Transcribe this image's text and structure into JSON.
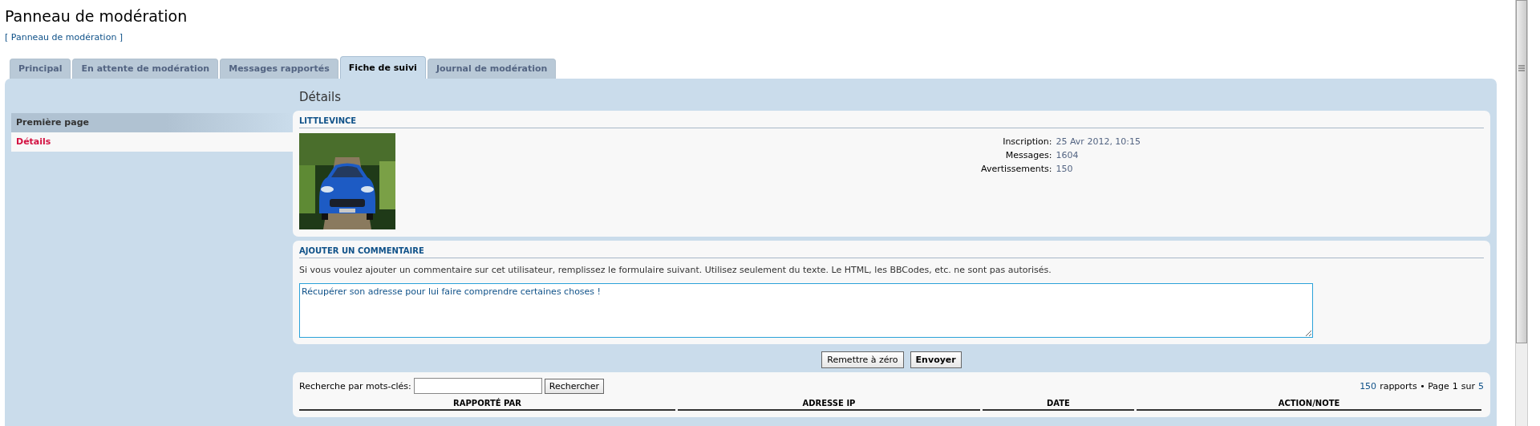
{
  "page_title": "Panneau de modération",
  "breadcrumb": "[ Panneau de modération ]",
  "tabs": [
    {
      "label": "Principal",
      "selected": false
    },
    {
      "label": "En attente de modération",
      "selected": false
    },
    {
      "label": "Messages rapportés",
      "selected": false
    },
    {
      "label": "Fiche de suivi",
      "selected": true
    },
    {
      "label": "Journal de modération",
      "selected": false
    }
  ],
  "sidebar": {
    "items": [
      {
        "label": "Première page",
        "kind": "header",
        "selected": false
      },
      {
        "label": "Détails",
        "kind": "link",
        "selected": true
      }
    ]
  },
  "section_title": "Détails",
  "user_card": {
    "username": "LITTLEVINCE",
    "fields": [
      {
        "label": "Inscription:",
        "value": "25 Avr 2012, 10:15"
      },
      {
        "label": "Messages:",
        "value": "1604"
      },
      {
        "label": "Avertissements:",
        "value": "150"
      }
    ]
  },
  "comment_card": {
    "title": "AJOUTER UN COMMENTAIRE",
    "description": "Si vous voulez ajouter un commentaire sur cet utilisateur, remplissez le formulaire suivant. Utilisez seulement du texte. Le HTML, les BBCodes, etc. ne sont pas autorisés.",
    "value": "Récupérer son adresse pour lui faire comprendre certaines choses !"
  },
  "buttons": [
    {
      "label": "Remettre à zéro",
      "primary": false
    },
    {
      "label": "Envoyer",
      "primary": true
    }
  ],
  "reports": {
    "search_label": "Recherche par mots-clés:",
    "search_button": "Rechercher",
    "pagination": {
      "count": "150",
      "count_label": "rapports • Page",
      "current": "1",
      "of": "sur",
      "last": "5"
    },
    "columns": [
      "RAPPORTÉ PAR",
      "ADRESSE IP",
      "DATE",
      "ACTION/NOTE"
    ]
  }
}
